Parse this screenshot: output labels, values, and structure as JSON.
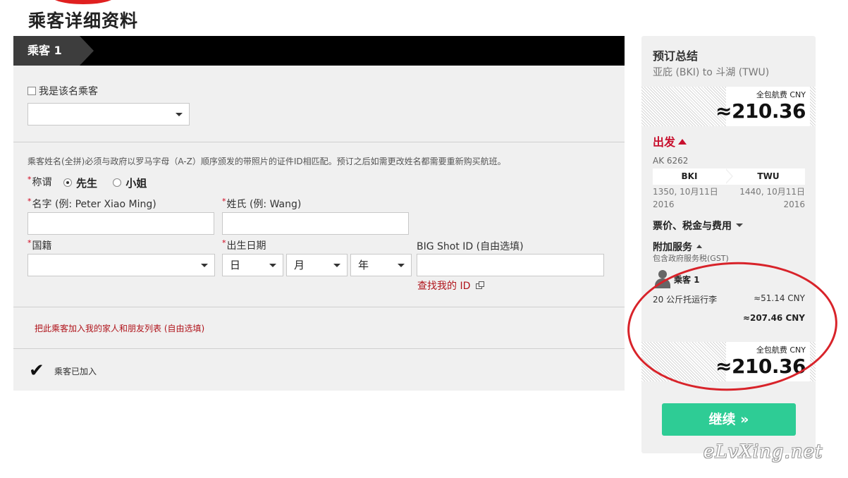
{
  "page": {
    "title": "乘客详细资料"
  },
  "passenger_form": {
    "tab_label": "乘客 1",
    "self_checkbox_label": "我是该名乘客",
    "self_select_value": "",
    "name_notice": "乘客姓名(全拼)必须与政府以罗马字母（A-Z）顺序颁发的带照片的证件ID相匹配。预订之后如需更改姓名都需要重新购买航班。",
    "required_mark": "*",
    "title_label": "称谓",
    "title_options": [
      "先生",
      "小姐"
    ],
    "title_selected": "先生",
    "first_name_label": "名字 (例: Peter Xiao Ming)",
    "first_name_value": "",
    "last_name_label": "姓氏 (例: Wang)",
    "last_name_value": "",
    "nationality_label": "国籍",
    "nationality_value": "",
    "dob_label": "出生日期",
    "dob_day": "日",
    "dob_month": "月",
    "dob_year": "年",
    "bigshot_label": "BIG Shot ID (自由选填)",
    "bigshot_value": "",
    "find_id_link": "查找我的 ID",
    "add_family_link": "把此乘客加入我的家人和朋友列表 (自由选填)",
    "added_text": "乘客已加入"
  },
  "summary": {
    "title": "预订总结",
    "route": "亚庇 (BKI) to 斗湖 (TWU)",
    "total_label": "全包航费 CNY",
    "total_value": "≈210.36",
    "depart_label": "出发",
    "flight_no": "AK 6262",
    "from_code": "BKI",
    "to_code": "TWU",
    "depart_time": "1350, 10月11日",
    "depart_year": "2016",
    "arrive_time": "1440, 10月11日",
    "arrive_year": "2016",
    "fare_toggle": "票价、税金与费用",
    "addon_title": "附加服务",
    "gst_note": "包含政府服务税(GST)",
    "pax_name": "乘客 1",
    "baggage_label": "20 公斤托运行李",
    "baggage_price": "≈51.14 CNY",
    "subtotal": "≈207.46 CNY",
    "bottom_total_label": "全包航费 CNY",
    "bottom_total_value": "≈210.36",
    "continue_label": "继续 »"
  },
  "watermark": "eLvXing.net",
  "colors": {
    "accent_green": "#2ecc95",
    "accent_red": "#c8102e",
    "header_black": "#000000"
  }
}
